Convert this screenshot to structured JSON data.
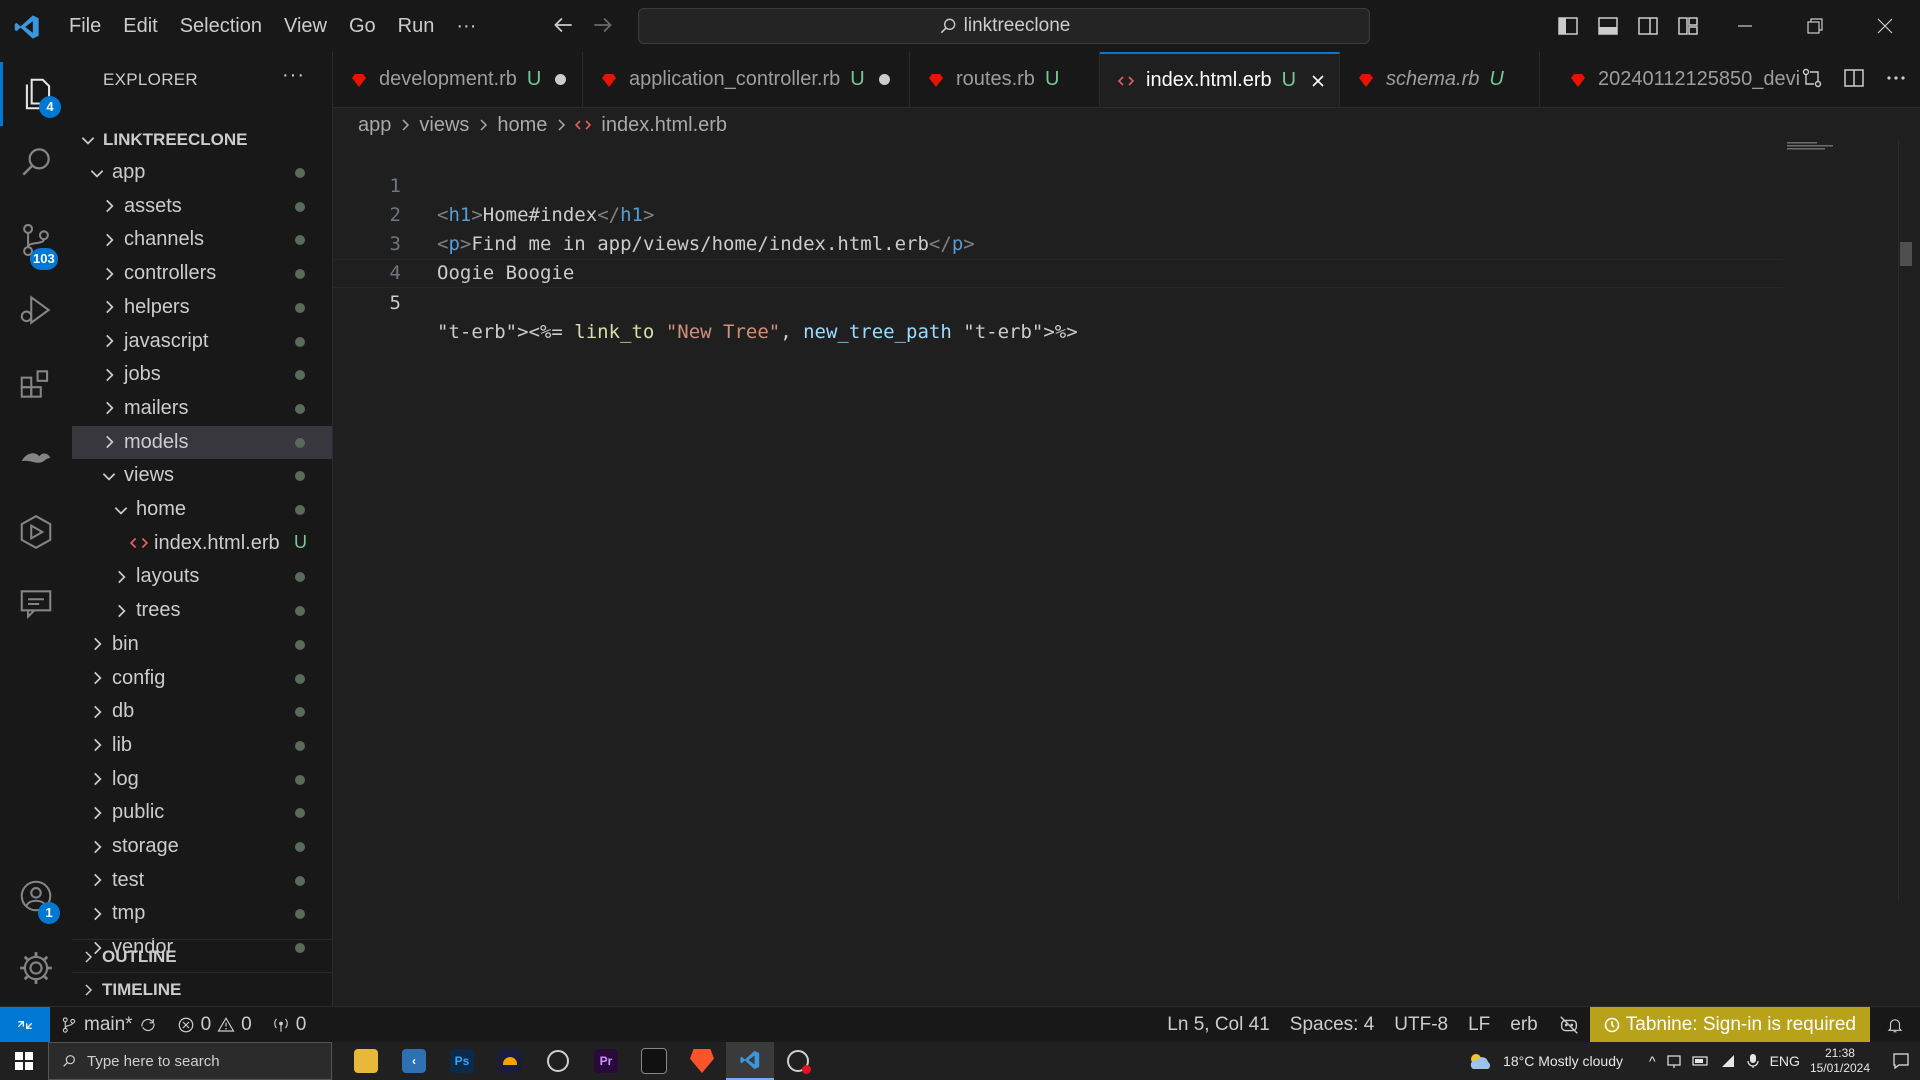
{
  "menu": [
    "File",
    "Edit",
    "Selection",
    "View",
    "Go",
    "Run",
    "···"
  ],
  "search": {
    "text": "linktreeclone"
  },
  "activity": {
    "explorer_badge": "4",
    "scm_badge": "103",
    "accounts_badge": "1"
  },
  "explorer": {
    "title": "EXPLORER",
    "more": "···",
    "root": "LINKTREECLONE",
    "tree": [
      {
        "label": "app",
        "depth": 1,
        "expanded": true
      },
      {
        "label": "assets",
        "depth": 2,
        "expanded": false
      },
      {
        "label": "channels",
        "depth": 2,
        "expanded": false
      },
      {
        "label": "controllers",
        "depth": 2,
        "expanded": false
      },
      {
        "label": "helpers",
        "depth": 2,
        "expanded": false
      },
      {
        "label": "javascript",
        "depth": 2,
        "expanded": false
      },
      {
        "label": "jobs",
        "depth": 2,
        "expanded": false
      },
      {
        "label": "mailers",
        "depth": 2,
        "expanded": false
      },
      {
        "label": "models",
        "depth": 2,
        "expanded": false,
        "selected": true
      },
      {
        "label": "views",
        "depth": 2,
        "expanded": true
      },
      {
        "label": "home",
        "depth": 3,
        "expanded": true
      },
      {
        "label": "index.html.erb",
        "depth": 4,
        "file": true,
        "status": "U"
      },
      {
        "label": "layouts",
        "depth": 3,
        "expanded": false
      },
      {
        "label": "trees",
        "depth": 3,
        "expanded": false
      },
      {
        "label": "bin",
        "depth": 1,
        "expanded": false
      },
      {
        "label": "config",
        "depth": 1,
        "expanded": false
      },
      {
        "label": "db",
        "depth": 1,
        "expanded": false
      },
      {
        "label": "lib",
        "depth": 1,
        "expanded": false
      },
      {
        "label": "log",
        "depth": 1,
        "expanded": false
      },
      {
        "label": "public",
        "depth": 1,
        "expanded": false
      },
      {
        "label": "storage",
        "depth": 1,
        "expanded": false
      },
      {
        "label": "test",
        "depth": 1,
        "expanded": false
      },
      {
        "label": "tmp",
        "depth": 1,
        "expanded": false
      },
      {
        "label": "vendor",
        "depth": 1,
        "expanded": false
      }
    ],
    "outline": "OUTLINE",
    "timeline": "TIMELINE"
  },
  "tabs": [
    {
      "label": "development.rb",
      "status": "U",
      "dirty": true,
      "icon": "ruby-icon"
    },
    {
      "label": "application_controller.rb",
      "status": "U",
      "dirty": true,
      "icon": "ruby-icon"
    },
    {
      "label": "routes.rb",
      "status": "U",
      "dirty": false,
      "icon": "ruby-icon"
    },
    {
      "label": "index.html.erb",
      "status": "U",
      "active": true,
      "icon": "erb-icon"
    },
    {
      "label": "schema.rb",
      "status": "U",
      "italic": true,
      "icon": "ruby-icon"
    },
    {
      "label": "20240112125850_devi",
      "status": "",
      "icon": "ruby-icon"
    }
  ],
  "breadcrumb": [
    "app",
    "views",
    "home",
    "index.html.erb"
  ],
  "editor": {
    "current_line": 5,
    "lines": [
      {
        "n": "1",
        "text": "<h1>Home#index</h1>"
      },
      {
        "n": "2",
        "text": "<p>Find me in app/views/home/index.html.erb</p>"
      },
      {
        "n": "3",
        "text": "Oogie Boogie"
      },
      {
        "n": "4",
        "text": ""
      },
      {
        "n": "5",
        "text": "<%= link_to \"New Tree\", new_tree_path %>"
      }
    ]
  },
  "status": {
    "branch": "main*",
    "errors": "0",
    "warnings": "0",
    "ports": "0",
    "position": "Ln 5, Col 41",
    "spaces": "Spaces: 4",
    "encoding": "UTF-8",
    "eol": "LF",
    "language": "erb",
    "tabnine": "Tabnine: Sign-in is required"
  },
  "taskbar": {
    "search_placeholder": "Type here to search",
    "weather": "18°C  Mostly cloudy",
    "lang": "ENG",
    "time": "21:38",
    "date": "15/01/2024"
  },
  "colors": {
    "accent": "#0078d4",
    "ruby": "#e51400",
    "tabnine": "#b8a21a",
    "modified": "#73c991"
  }
}
